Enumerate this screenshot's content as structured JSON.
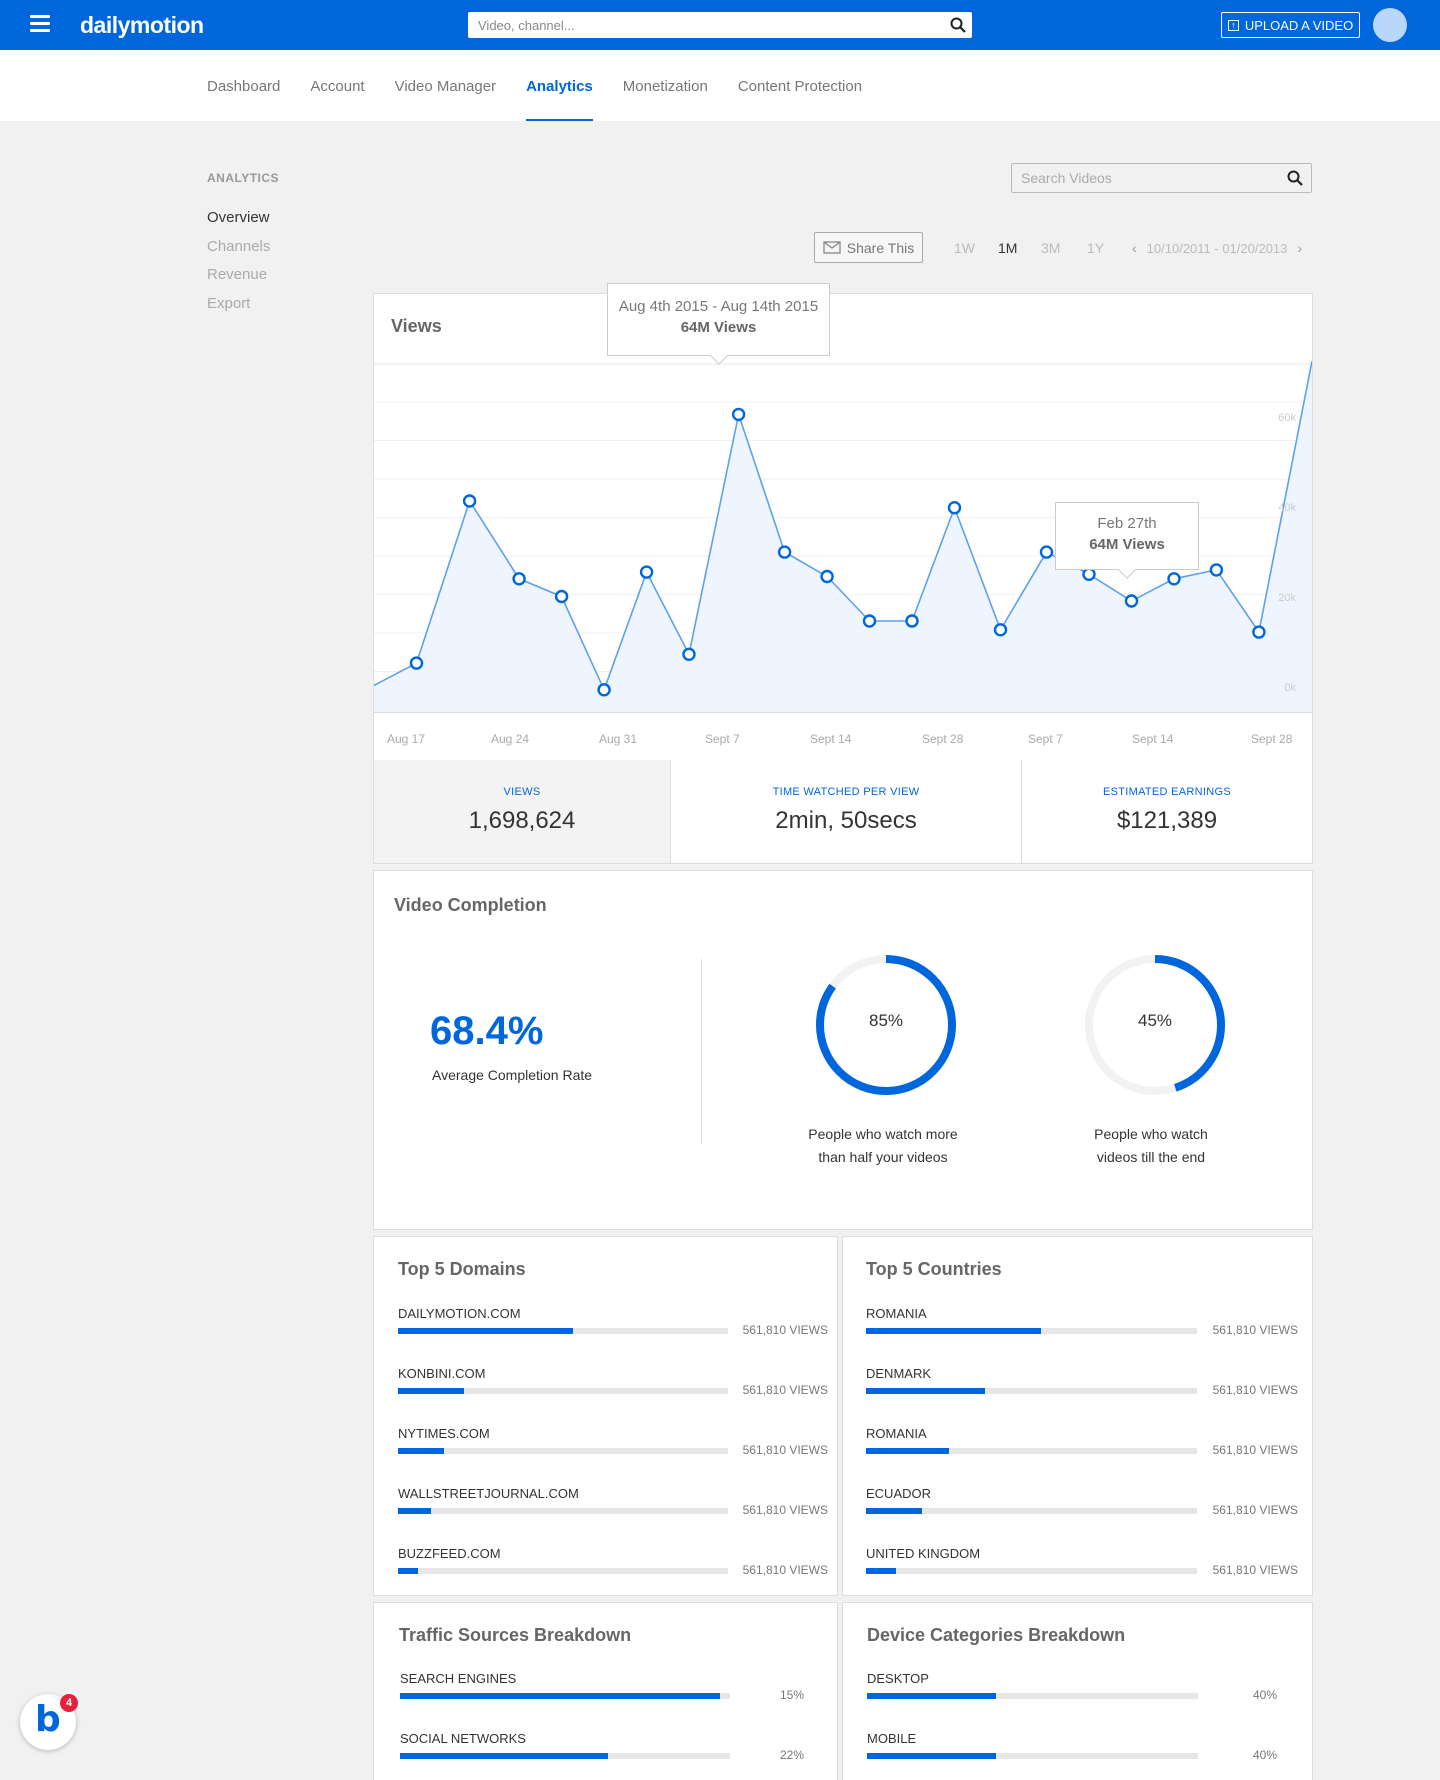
{
  "header": {
    "logo": "dailymotion",
    "search_placeholder": "Video, channel...",
    "upload_label": "UPLOAD A VIDEO",
    "brand_color": "#0066dc"
  },
  "nav": {
    "tabs": [
      "Dashboard",
      "Account",
      "Video Manager",
      "Analytics",
      "Monetization",
      "Content Protection"
    ],
    "active": "Analytics"
  },
  "sidebar": {
    "heading": "ANALYTICS",
    "items": [
      "Overview",
      "Channels",
      "Revenue",
      "Export"
    ],
    "active": "Overview"
  },
  "toolbar": {
    "search_placeholder": "Search Videos",
    "share_label": "Share This",
    "ranges": [
      "1W",
      "1M",
      "3M",
      "1Y"
    ],
    "active_range": "1M",
    "date_range": "10/10/2011 - 01/20/2013"
  },
  "views_chart": {
    "title": "Views",
    "tooltip_peak": {
      "date": "Aug 4th 2015 - Aug 14th 2015",
      "value": "64M Views"
    },
    "tooltip_point": {
      "date": "Feb 27th",
      "value": "64M Views"
    }
  },
  "chart_data": {
    "type": "line",
    "title": "Views",
    "x_tick_labels": [
      "Aug 17",
      "Aug 24",
      "Aug 31",
      "Sept 7",
      "Sept 14",
      "Sept 28",
      "Sept 7",
      "Sept 14",
      "Sept 28"
    ],
    "y_tick_labels": [
      "0k",
      "20k",
      "40k",
      "60k"
    ],
    "ylim": [
      0,
      68
    ],
    "y_unit": "k",
    "grid": true,
    "series": [
      {
        "points": [
          [
            0.0,
            6.0
          ],
          [
            1.2,
            11.0
          ],
          [
            2.7,
            47.5
          ],
          [
            4.1,
            30.0
          ],
          [
            5.3,
            26.0
          ],
          [
            6.5,
            5.0
          ],
          [
            7.7,
            31.5
          ],
          [
            8.9,
            13.0
          ],
          [
            10.3,
            67.0
          ],
          [
            11.6,
            36.0
          ],
          [
            12.8,
            30.5
          ],
          [
            14.0,
            20.5
          ],
          [
            15.2,
            20.5
          ],
          [
            16.4,
            46.0
          ],
          [
            17.7,
            18.5
          ],
          [
            19.0,
            36.0
          ],
          [
            20.2,
            31.0
          ],
          [
            21.4,
            25.0
          ],
          [
            22.6,
            30.0
          ],
          [
            23.8,
            32.0
          ],
          [
            25.0,
            18.0
          ],
          [
            26.5,
            79.0
          ]
        ],
        "point_label": "Views"
      }
    ]
  },
  "stats": [
    {
      "label": "VIEWS",
      "value": "1,698,624"
    },
    {
      "label": "TIME WATCHED PER VIEW",
      "value": "2min, 50secs"
    },
    {
      "label": "ESTIMATED EARNINGS",
      "value": "$121,389"
    }
  ],
  "completion": {
    "title": "Video Completion",
    "average": "68.4%",
    "average_label": "Average Completion Rate",
    "donuts": [
      {
        "pct": 85,
        "label": "85%",
        "caption_line1": "People who watch more",
        "caption_line2": "than half your videos"
      },
      {
        "pct": 45,
        "label": "45%",
        "caption_line1": "People who watch",
        "caption_line2": "videos till the end"
      }
    ]
  },
  "domains": {
    "title": "Top 5 Domains",
    "rows": [
      {
        "label": "DAILYMOTION.COM",
        "value": "561,810 VIEWS",
        "fraction": 0.53
      },
      {
        "label": "KONBINI.COM",
        "value": "561,810 VIEWS",
        "fraction": 0.2
      },
      {
        "label": "NYTIMES.COM",
        "value": "561,810 VIEWS",
        "fraction": 0.14
      },
      {
        "label": "WALLSTREETJOURNAL.COM",
        "value": "561,810 VIEWS",
        "fraction": 0.1
      },
      {
        "label": "BUZZFEED.COM",
        "value": "561,810 VIEWS",
        "fraction": 0.06
      }
    ]
  },
  "countries": {
    "title": "Top 5 Countries",
    "rows": [
      {
        "label": "ROMANIA",
        "value": "561,810 VIEWS",
        "fraction": 0.53
      },
      {
        "label": "DENMARK",
        "value": "561,810 VIEWS",
        "fraction": 0.36
      },
      {
        "label": "ROMANIA",
        "value": "561,810 VIEWS",
        "fraction": 0.25
      },
      {
        "label": "ECUADOR",
        "value": "561,810 VIEWS",
        "fraction": 0.17
      },
      {
        "label": "UNITED KINGDOM",
        "value": "561,810 VIEWS",
        "fraction": 0.09
      }
    ]
  },
  "traffic": {
    "title": "Traffic Sources Breakdown",
    "rows": [
      {
        "label": "SEARCH ENGINES",
        "value": "15%",
        "fraction": 0.97
      },
      {
        "label": "SOCIAL NETWORKS",
        "value": "22%",
        "fraction": 0.63
      }
    ]
  },
  "devices": {
    "title": "Device Categories Breakdown",
    "rows": [
      {
        "label": "DESKTOP",
        "value": "40%",
        "fraction": 0.39
      },
      {
        "label": "MOBILE",
        "value": "40%",
        "fraction": 0.39
      }
    ]
  },
  "notification": {
    "letter": "b",
    "count": "4"
  }
}
